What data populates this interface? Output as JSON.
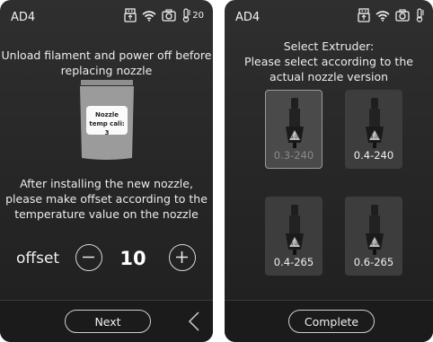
{
  "left_screen": {
    "model": "AD4",
    "temperature": "20",
    "instruction": "Unload filament and power off before replacing nozzle",
    "instruction_line1": "Unload filament and power off before",
    "instruction_line2": "replacing nozzle",
    "nozzle_card_line1": "Nozzle",
    "nozzle_card_line2": "temp cali: 3",
    "after_line1": "After installing the new nozzle,",
    "after_line2": "please make offset according to the",
    "after_line3": "temperature value on the nozzle",
    "offset_label": "offset",
    "offset_value": "10",
    "next_label": "Next"
  },
  "right_screen": {
    "model": "AD4",
    "title_line1": "Select Extruder:",
    "title_line2": "Please select according to the",
    "title_line3": "actual nozzle version",
    "options": [
      {
        "label": "0.3-240",
        "engraving": "0.3-240",
        "selected": true
      },
      {
        "label": "0.4-240",
        "engraving": "0.4-240",
        "selected": false
      },
      {
        "label": "0.4-265",
        "engraving": "0.4-265",
        "selected": false
      },
      {
        "label": "0.6-265",
        "engraving": "0.6-265",
        "selected": false
      }
    ],
    "complete_label": "Complete"
  },
  "icons": {
    "usb": "usb-icon",
    "wifi": "wifi-icon",
    "camera": "camera-icon",
    "thermometer": "thermometer-icon",
    "minus": "minus-circle-icon",
    "plus": "plus-circle-icon",
    "back": "chevron-left-icon"
  },
  "colors": {
    "background": "#2a2a2a",
    "text": "#ececec",
    "disabled_text": "#8a8a8a",
    "tile": "#3d3d3d"
  }
}
